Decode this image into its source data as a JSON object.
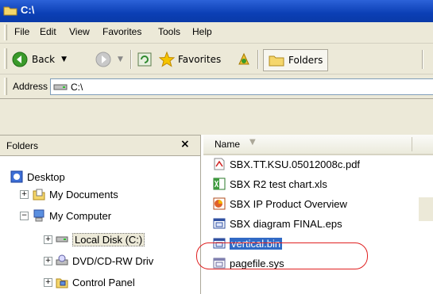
{
  "window": {
    "title": "C:\\"
  },
  "menu": {
    "items": [
      "File",
      "Edit",
      "View",
      "Favorites",
      "Tools",
      "Help"
    ]
  },
  "toolbar": {
    "back": "Back",
    "favorites": "Favorites",
    "folders": "Folders"
  },
  "address": {
    "label": "Address",
    "value": "C:\\"
  },
  "folders_pane": {
    "title": "Folders",
    "close": "×",
    "tree": [
      "Desktop",
      "My Documents",
      "My Computer",
      "Local Disk (C:)",
      "DVD/CD-RW Driv",
      "Control Panel"
    ]
  },
  "file_list": {
    "column_name": "Name",
    "files": [
      "SBX.TT.KSU.05012008c.pdf",
      "SBX R2 test chart.xls",
      "SBX IP Product Overview",
      "SBX diagram FINAL.eps",
      "vertical.bin",
      "pagefile.sys"
    ],
    "selected": "vertical.bin"
  },
  "colors": {
    "title_bar": "#0b3fb5",
    "selection": "#316ac5",
    "annotation": "#e02020"
  }
}
